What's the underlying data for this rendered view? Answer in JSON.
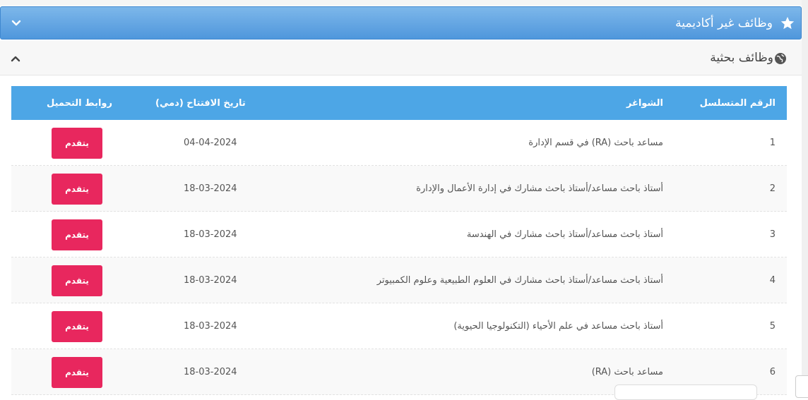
{
  "panels": {
    "non_academic": {
      "title": "وظائف غير أكاديمية"
    },
    "research": {
      "title": "وظائف بحثية"
    }
  },
  "table": {
    "headers": {
      "serial": "الرقم المتسلسل",
      "vacancies": "الشواغر",
      "opening_date": "تاريخ الافتتاح (دمي)",
      "links": "روابط التحميل"
    },
    "rows": [
      {
        "serial": "1",
        "vacancy": "مساعد باحث (RA) في قسم الإدارة",
        "date": "04-04-2024",
        "action": "يتقدم"
      },
      {
        "serial": "2",
        "vacancy": "أستاذ باحث مساعد/أستاذ باحث مشارك في إدارة الأعمال والإدارة",
        "date": "18-03-2024",
        "action": "يتقدم"
      },
      {
        "serial": "3",
        "vacancy": "أستاذ باحث مساعد/أستاذ باحث مشارك في الهندسة",
        "date": "18-03-2024",
        "action": "يتقدم"
      },
      {
        "serial": "4",
        "vacancy": "أستاذ باحث مساعد/أستاذ باحث مشارك في العلوم الطبيعية وعلوم الكمبيوتر",
        "date": "18-03-2024",
        "action": "يتقدم"
      },
      {
        "serial": "5",
        "vacancy": "أستاذ باحث مساعد في علم الأحياء (التكنولوجيا الحيوية)",
        "date": "18-03-2024",
        "action": "يتقدم"
      },
      {
        "serial": "6",
        "vacancy": "مساعد باحث (RA)",
        "date": "18-03-2024",
        "action": "يتقدم"
      }
    ]
  },
  "colors": {
    "header_blue": "#4f97dc",
    "table_head": "#4da6e6",
    "apply_button": "#e8275e"
  },
  "icons": {
    "star": "star-icon",
    "globe": "globe-icon",
    "chevron_down": "chevron-down-icon",
    "chevron_up": "chevron-up-icon"
  }
}
